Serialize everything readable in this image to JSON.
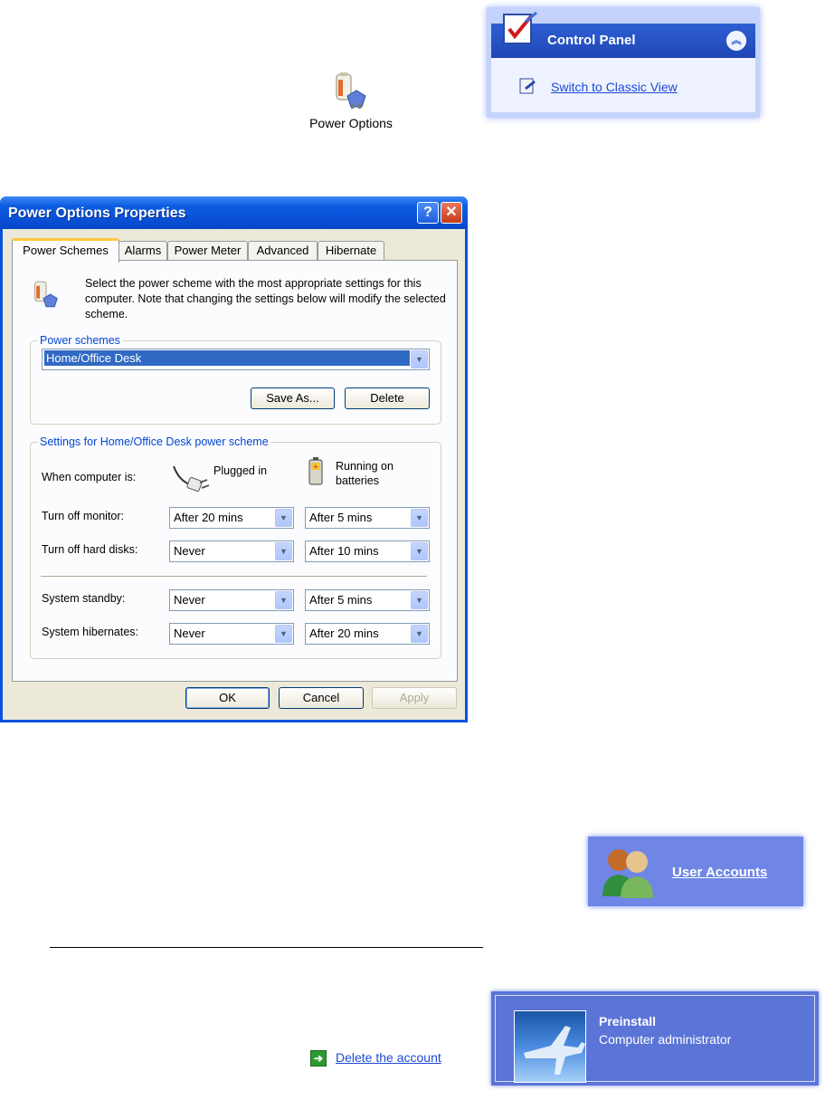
{
  "desktop_icon": {
    "label": "Power Options",
    "icon": "power-options-icon"
  },
  "control_panel": {
    "title": "Control Panel",
    "link": "Switch to Classic View",
    "icons": {
      "panel": "control-panel-icon",
      "collapse": "chevron-up-icon",
      "link": "switch-view-icon"
    }
  },
  "dialog": {
    "title": "Power Options Properties",
    "tabs": [
      "Power Schemes",
      "Alarms",
      "Power Meter",
      "Advanced",
      "Hibernate"
    ],
    "intro": "Select the power scheme with the most appropriate settings for this computer. Note that changing the settings below will modify the selected scheme.",
    "schemes_group": {
      "legend": "Power schemes",
      "selected": "Home/Office Desk",
      "save_as": "Save As...",
      "delete": "Delete"
    },
    "settings_group": {
      "legend": "Settings for Home/Office Desk power scheme",
      "when_label": "When computer is:",
      "plugged_in": "Plugged in",
      "batteries_line1": "Running on",
      "batteries_line2": "batteries",
      "rows": [
        {
          "label": "Turn off monitor:",
          "plugged": "After 20 mins",
          "battery": "After 5 mins"
        },
        {
          "label": "Turn off hard disks:",
          "plugged": "Never",
          "battery": "After 10 mins"
        },
        {
          "label": "System standby:",
          "plugged": "Never",
          "battery": "After 5 mins"
        },
        {
          "label": "System hibernates:",
          "plugged": "Never",
          "battery": "After 20 mins"
        }
      ]
    },
    "buttons": {
      "ok": "OK",
      "cancel": "Cancel",
      "apply": "Apply"
    },
    "title_buttons": {
      "help": "?",
      "close": "✕"
    }
  },
  "user_accounts": {
    "label": "User Accounts",
    "icon": "user-accounts-icon"
  },
  "account_link": {
    "label": "Delete the account",
    "icon": "green-arrow-icon"
  },
  "account_tile": {
    "name": "Preinstall",
    "role": "Computer administrator",
    "picture": "airplane-picture"
  },
  "colors": {
    "xp_title_blue": "#0a53de",
    "dialog_face": "#ece9d8",
    "link_blue": "#1c49d6",
    "tab_highlight": "#ffc73c"
  }
}
